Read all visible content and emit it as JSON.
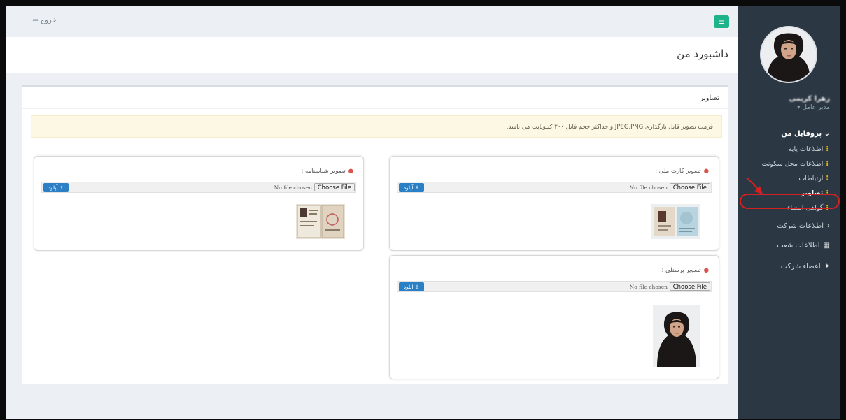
{
  "topbar": {
    "menu_icon": "hamburger-icon",
    "logout_label": "خروج",
    "logout_icon": "logout-icon"
  },
  "page": {
    "title": "داشبورد من"
  },
  "sidebar": {
    "user_name": "زهرا کریمی",
    "user_role": "مدیر عامل ▾",
    "profile_menu": "پروفایل من",
    "profile_items": [
      {
        "label": "اطلاعات پایه"
      },
      {
        "label": "اطلاعات محل سکونت"
      },
      {
        "label": "ارتباطات"
      },
      {
        "label": "تصاویر"
      },
      {
        "label": "گواهی امضاء"
      }
    ],
    "company_info": "اطلاعات شرکت",
    "branches": "اطلاعات شعب",
    "members": "اعضاء شرکت"
  },
  "box": {
    "title": "تصاویر",
    "alert": "فرمت تصویر قابل بارگذاری JPEG,PNG و حداکثر حجم فایل ۲۰۰ کیلوبایت می باشد."
  },
  "cards": {
    "national_card": {
      "label": "تصویر کارت ملی :"
    },
    "birth_certificate": {
      "label": "تصویر شناسنامه :"
    },
    "personal_photo": {
      "label": "تصویر پرسنلی :"
    }
  },
  "file_input": {
    "choose_label": "Choose File",
    "no_file_label": "No file chosen",
    "upload_label": "آپلود"
  }
}
